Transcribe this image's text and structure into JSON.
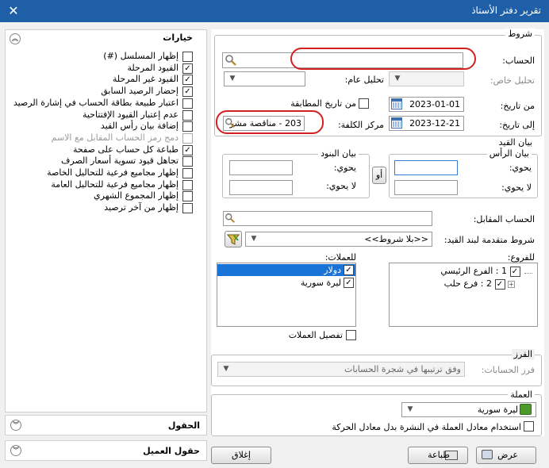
{
  "window": {
    "title": "تقرير دفتر الأستاذ"
  },
  "options": {
    "title": "خيارات",
    "items": [
      {
        "label": "إظهار المسلسل (#)",
        "checked": false,
        "disabled": false
      },
      {
        "label": "القيود المرحلة",
        "checked": true,
        "disabled": false
      },
      {
        "label": "القيود غير المرحلة",
        "checked": true,
        "disabled": false
      },
      {
        "label": "إحضار الرصيد السابق",
        "checked": true,
        "disabled": false
      },
      {
        "label": "اعتبار طبيعة بطاقة الحساب في إشارة الرصيد",
        "checked": false,
        "disabled": false
      },
      {
        "label": "عدم إعتبار القيود الإفتتاحية",
        "checked": false,
        "disabled": false
      },
      {
        "label": "إضافة بيان رأس القيد",
        "checked": false,
        "disabled": false
      },
      {
        "label": "دمج رمز الحساب المقابل مع الاسم",
        "checked": false,
        "disabled": true
      },
      {
        "label": "طباعة كل حساب على صفحة",
        "checked": true,
        "disabled": false
      },
      {
        "label": "تجاهل قيود تسوية أسعار الصرف",
        "checked": false,
        "disabled": false
      },
      {
        "label": "إظهار مجاميع فرعية للتحاليل الخاصة",
        "checked": false,
        "disabled": false
      },
      {
        "label": "إظهار مجاميع فرعية للتحاليل العامة",
        "checked": false,
        "disabled": false
      },
      {
        "label": "إظهار المجموع الشهري",
        "checked": false,
        "disabled": false
      },
      {
        "label": "إظهار من آخر ترصيد",
        "checked": false,
        "disabled": false
      }
    ]
  },
  "sections": {
    "fields": "الحقول",
    "customer_fields": "حقول العميل"
  },
  "conditions": {
    "title": "شروط",
    "account_label": "الحساب:",
    "account_value": "",
    "special_analysis_label": "تحليل خاص:",
    "general_analysis_label": "تحليل عام:",
    "from_date_label": "من تاريخ:",
    "from_date": "2023-01-01",
    "to_date_label": "إلى تاريخ:",
    "to_date": "2023-12-21",
    "from_match_date_label": "من تاريخ المطابقة",
    "cost_center_label": "مركز الكلفة:",
    "cost_center_value": "203 - مناقصة مشر"
  },
  "entry_statement": {
    "title": "بيان القيد",
    "header_title": "بيان الرأس",
    "items_title": "بيان البنود",
    "contains": "يحوي:",
    "not_contains": "لا يحوي:",
    "or_label": "أو",
    "header_contains_value": "",
    "header_not_contains_value": "",
    "items_contains_value": "",
    "items_not_contains_value": ""
  },
  "counter_account_label": "الحساب المقابل:",
  "advanced_conditions_label": "شروط متقدمة لبند القيد:",
  "advanced_conditions_value": "<<بلا شروط>>",
  "branches": {
    "label": "للفروع:",
    "items": [
      {
        "label": "1 : الفرع الرئيسي",
        "checked": true
      },
      {
        "label": "2 : فرع حلب",
        "checked": true
      }
    ]
  },
  "currencies": {
    "label": "للعملات:",
    "items": [
      {
        "label": "دولار",
        "checked": true,
        "selected": true
      },
      {
        "label": "ليرة سورية",
        "checked": true,
        "selected": false
      }
    ],
    "detail_label": "تفصيل العملات"
  },
  "sort": {
    "title": "الفرز",
    "accounts_sort_label": "فرز الحسابات:",
    "accounts_sort_value": "وفق ترتيبها في شجرة الحسابات"
  },
  "currency": {
    "title": "العملة",
    "value": "ليرة سورية",
    "use_rate_label": "استخدام معادل العملة في النشرة بدل معادل الحركة"
  },
  "buttons": {
    "show": "عرض",
    "print": "طباعة",
    "close": "إغلاق"
  },
  "colors": {
    "titlebar": "#1f5fa8",
    "selection": "#1a73d6",
    "highlight_ring": "#d42020"
  }
}
